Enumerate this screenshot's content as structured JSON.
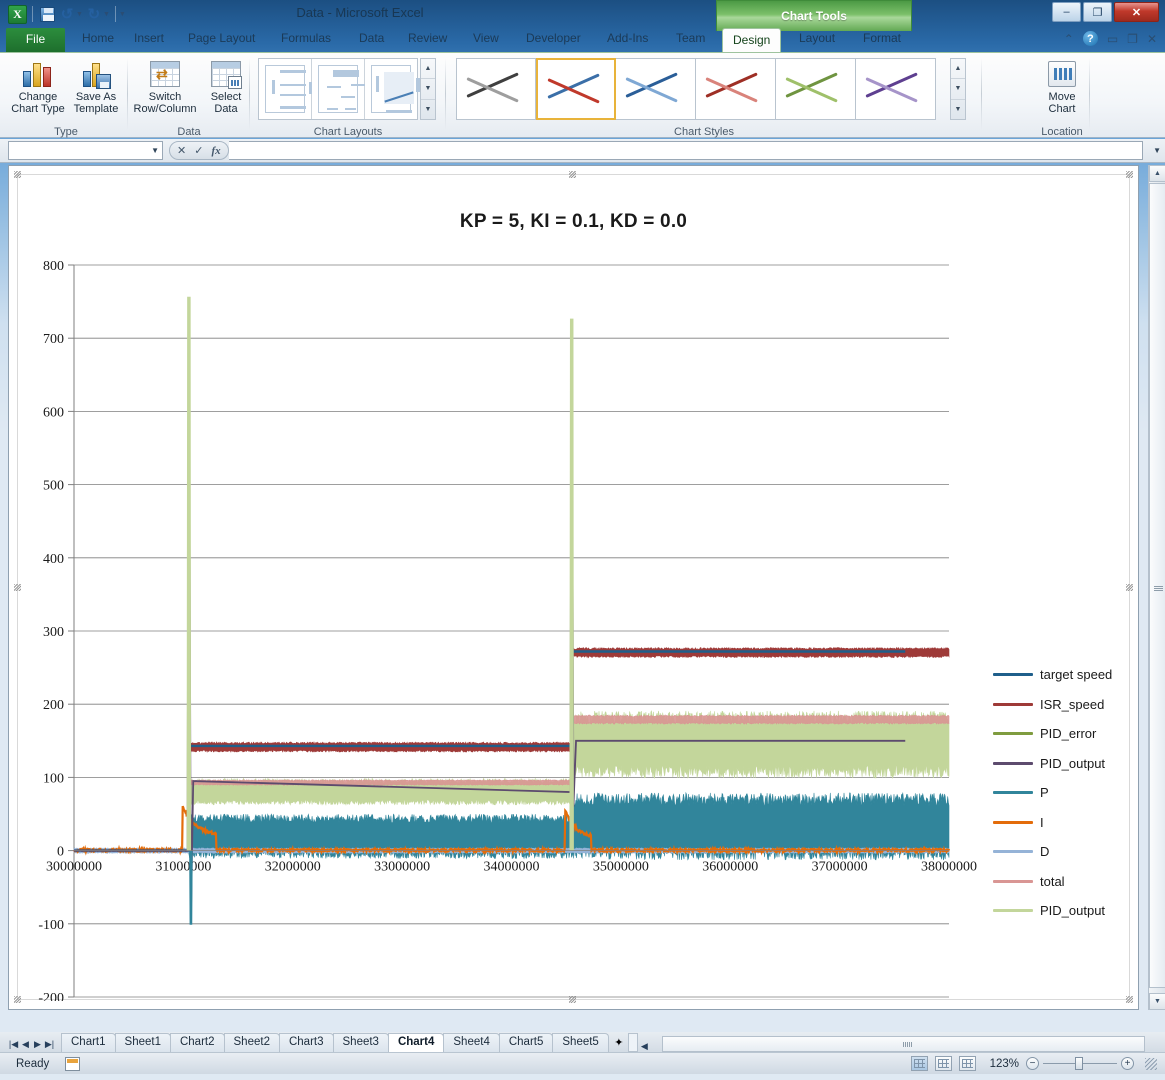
{
  "window": {
    "title": "Data  -  Microsoft Excel",
    "contextual_tab_group": "Chart Tools",
    "minimize": "–",
    "restore": "❐",
    "close": "✕"
  },
  "quick_access": [
    {
      "name": "excel-logo",
      "label": "X"
    },
    {
      "name": "save-icon",
      "label": ""
    },
    {
      "name": "undo-icon",
      "label": "↺"
    },
    {
      "name": "redo-icon",
      "label": "↻"
    },
    {
      "name": "customize-qat-icon",
      "label": "▼"
    }
  ],
  "ribbon_tabs": [
    {
      "label": "File"
    },
    {
      "label": "Home"
    },
    {
      "label": "Insert"
    },
    {
      "label": "Page Layout"
    },
    {
      "label": "Formulas"
    },
    {
      "label": "Data"
    },
    {
      "label": "Review"
    },
    {
      "label": "View"
    },
    {
      "label": "Developer"
    },
    {
      "label": "Add-Ins"
    },
    {
      "label": "Team"
    },
    {
      "label": "Design"
    },
    {
      "label": "Layout"
    },
    {
      "label": "Format"
    }
  ],
  "ribbon": {
    "groups": [
      {
        "name": "type",
        "label": "Type"
      },
      {
        "name": "data",
        "label": "Data"
      },
      {
        "name": "chart-layouts",
        "label": "Chart Layouts"
      },
      {
        "name": "chart-styles",
        "label": "Chart Styles"
      },
      {
        "name": "location",
        "label": "Location"
      }
    ],
    "buttons": {
      "change_chart_type": "Change\nChart Type",
      "change_chart_type_l1": "Change",
      "change_chart_type_l2": "Chart Type",
      "save_as_template_l1": "Save As",
      "save_as_template_l2": "Template",
      "switch_row_column_l1": "Switch",
      "switch_row_column_l2": "Row/Column",
      "select_data_l1": "Select",
      "select_data_l2": "Data",
      "move_chart_l1": "Move",
      "move_chart_l2": "Chart"
    },
    "style_colors": [
      {
        "a": "#9e9e9e",
        "b": "#3f3f3f"
      },
      {
        "a": "#c0392b",
        "b": "#3b6fa8"
      },
      {
        "a": "#7fa8d4",
        "b": "#2a5e98"
      },
      {
        "a": "#d9837b",
        "b": "#9e2f25"
      },
      {
        "a": "#9fc06a",
        "b": "#6f9440"
      },
      {
        "a": "#a694c9",
        "b": "#5e3f90"
      }
    ],
    "selected_style_index": 1
  },
  "formula_bar": {
    "name_box_value": "",
    "fx_label": "fx",
    "formula_value": ""
  },
  "chart_data": {
    "type": "line",
    "title": "KP = 5, KI = 0.1, KD = 0.0",
    "xlabel": "",
    "ylabel": "",
    "xlim": [
      30000000,
      38000000
    ],
    "ylim": [
      -200,
      800
    ],
    "x_ticks": [
      30000000,
      31000000,
      32000000,
      33000000,
      34000000,
      35000000,
      36000000,
      37000000,
      38000000
    ],
    "y_ticks": [
      -200,
      -100,
      0,
      100,
      200,
      300,
      400,
      500,
      600,
      700,
      800
    ],
    "grid": "horizontal",
    "legend_position": "right",
    "series": [
      {
        "name": "target speed",
        "color": "#1f5f8b"
      },
      {
        "name": "ISR_speed",
        "color": "#9e3a38"
      },
      {
        "name": "PID_error",
        "color": "#7f9c3f"
      },
      {
        "name": "PID_output",
        "color": "#5d4b6e"
      },
      {
        "name": "P",
        "color": "#31859b"
      },
      {
        "name": "I",
        "color": "#e36c0a"
      },
      {
        "name": "D",
        "color": "#95b3d7"
      },
      {
        "name": "total",
        "color": "#d99694"
      },
      {
        "name": "PID_output",
        "color": "#c3d69b"
      }
    ],
    "annotations": [
      {
        "text": "first step at x≈31,050,000; PID_error spike peaks ≈755",
        "x": 31050000,
        "y": 755
      },
      {
        "text": "second step at x≈34,550,000; PID_error spike peaks ≈725",
        "x": 34550000,
        "y": 725
      },
      {
        "text": "ISR_speed settles ≈140 after first step",
        "x": 32500000,
        "y": 140
      },
      {
        "text": "ISR_speed settles ≈270 after second step",
        "x": 36000000,
        "y": 270
      },
      {
        "text": "PID_error band ≈70-95 after first step",
        "x": 32500000,
        "y": 82
      },
      {
        "text": "PID_error band ≈110-180 after second step",
        "x": 36000000,
        "y": 145
      },
      {
        "text": "P band ≈0-40 after first step, ≈0-65 after second step",
        "x": 34000000,
        "y": 25
      },
      {
        "text": "undershoot of P to ≈-100 during first transient",
        "x": 31100000,
        "y": -100
      }
    ]
  },
  "sheet_tabs": {
    "nav": [
      "|◀",
      "◀",
      "▶",
      "▶|"
    ],
    "tabs": [
      {
        "label": "Chart1",
        "active": false
      },
      {
        "label": "Sheet1",
        "active": false
      },
      {
        "label": "Chart2",
        "active": false
      },
      {
        "label": "Sheet2",
        "active": false
      },
      {
        "label": "Chart3",
        "active": false
      },
      {
        "label": "Sheet3",
        "active": false
      },
      {
        "label": "Chart4",
        "active": true
      },
      {
        "label": "Sheet4",
        "active": false
      },
      {
        "label": "Chart5",
        "active": false
      },
      {
        "label": "Sheet5",
        "active": false
      }
    ],
    "insert_sheet_label": "✦"
  },
  "status_bar": {
    "state": "Ready",
    "zoom": "123%",
    "zoom_out": "−",
    "zoom_in": "+",
    "views": [
      "normal-view",
      "page-layout-view",
      "page-break-view"
    ]
  },
  "help_icons": {
    "collapse_ribbon": "⌃",
    "help": "?",
    "minimize_window": "▭",
    "restore_window": "❐",
    "close_window": "✕"
  }
}
